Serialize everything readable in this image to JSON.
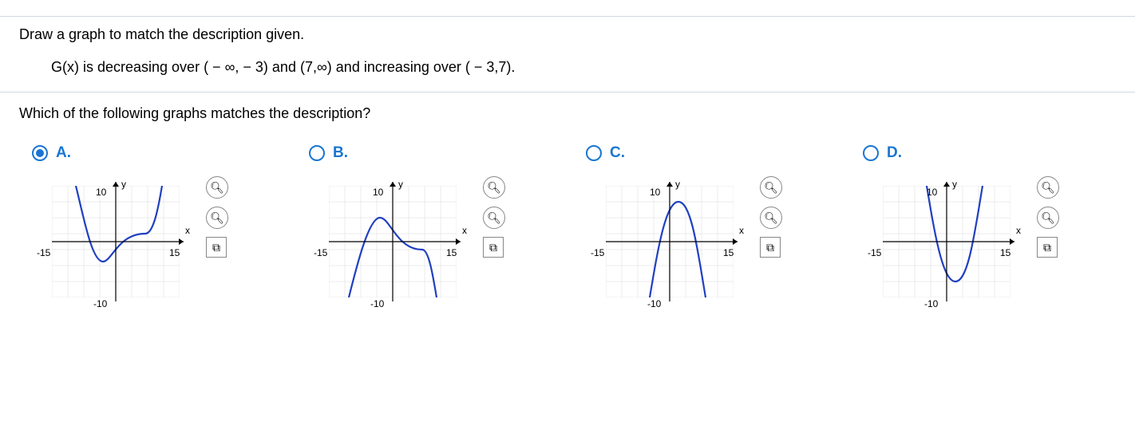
{
  "question": "Draw a graph to match the description given.",
  "description": "G(x) is decreasing over ( − ∞, − 3) and (7,∞) and increasing over ( − 3,7).",
  "prompt": "Which of the following graphs matches the description?",
  "options": [
    {
      "label": "A.",
      "selected": true
    },
    {
      "label": "B.",
      "selected": false
    },
    {
      "label": "C.",
      "selected": false
    },
    {
      "label": "D.",
      "selected": false
    }
  ],
  "axis": {
    "y_label": "y",
    "x_label": "x",
    "y_max": "10",
    "y_min": "-10",
    "x_max": "15",
    "x_min": "-15"
  },
  "icons": {
    "zoom_in": "⊕",
    "zoom_out": "⊖",
    "expand": "⇱"
  }
}
